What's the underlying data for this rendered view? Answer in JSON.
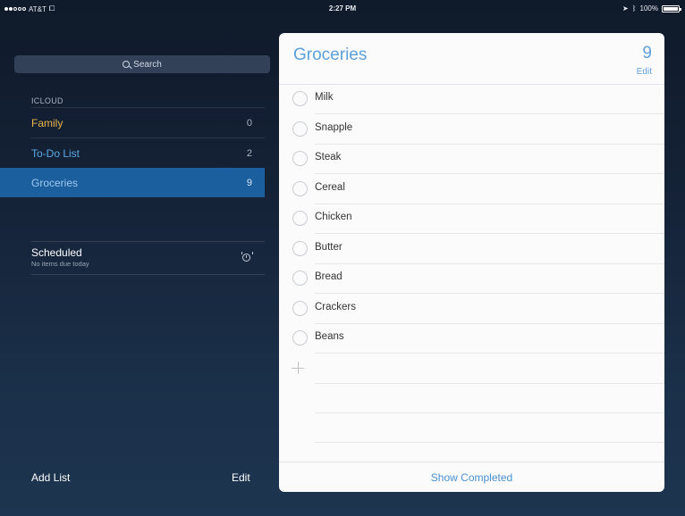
{
  "status_bar": {
    "carrier": "AT&T",
    "time": "2:27 PM",
    "battery": "100%"
  },
  "sidebar": {
    "search_placeholder": "Search",
    "section_label": "ICLOUD",
    "lists": [
      {
        "name": "Family",
        "count": "0",
        "color": "#e8b64a"
      },
      {
        "name": "To-Do List",
        "count": "2",
        "color": "#5aa9e6"
      },
      {
        "name": "Groceries",
        "count": "9",
        "color": "#7fb6e6"
      }
    ],
    "scheduled": {
      "title": "Scheduled",
      "subtitle": "No items due today"
    },
    "add_list_label": "Add List",
    "edit_label": "Edit"
  },
  "panel": {
    "title": "Groceries",
    "count": "9",
    "edit_label": "Edit",
    "items": [
      "Milk",
      "Snapple",
      "Steak",
      "Cereal",
      "Chicken",
      "Butter",
      "Bread",
      "Crackers",
      "Beans"
    ],
    "show_completed_label": "Show Completed",
    "accent": "#5da0d9"
  }
}
